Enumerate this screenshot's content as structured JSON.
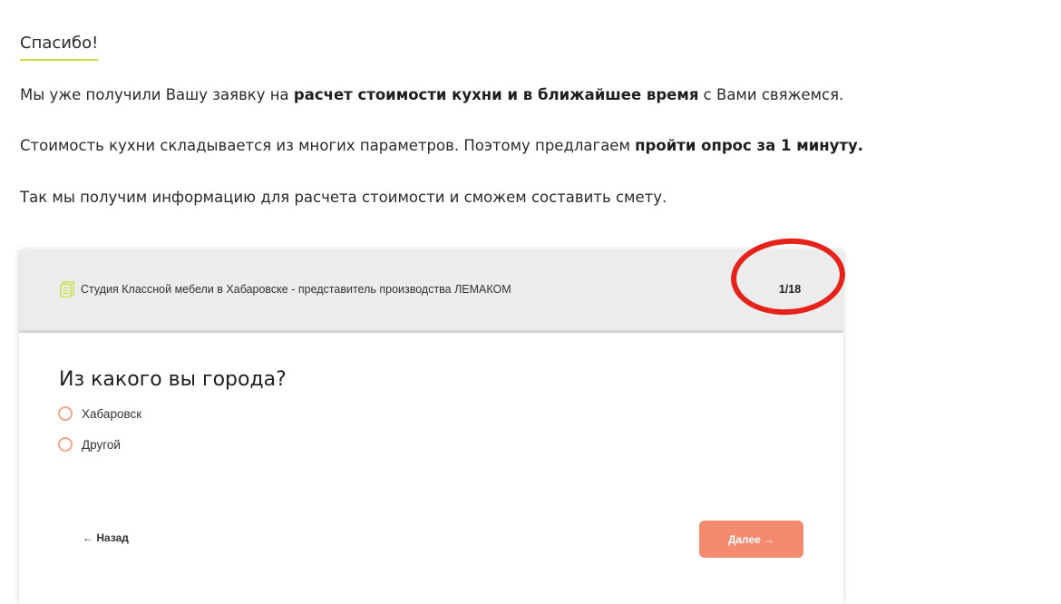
{
  "thanks": {
    "title": "Спасибо!"
  },
  "paragraphs": {
    "p1": {
      "before": "Мы уже получили Вашу заявку на ",
      "bold": "расчет стоимости кухни и в ближайшее время",
      "after": " с Вами свяжемся."
    },
    "p2": {
      "before": "Стоимость кухни складывается из многих параметров. Поэтому предлагаем ",
      "bold": "пройти опрос за 1 минуту."
    },
    "p3": {
      "text": "Так мы получим информацию для расчета стоимости и сможем составить смету."
    }
  },
  "quiz": {
    "studio_name": "Студия Классной мебели в Хабаровске - представитель производства ЛЕМАКОМ",
    "counter": "1/18",
    "question": "Из какого вы города?",
    "options": [
      {
        "label": "Хабаровск",
        "selected": false
      },
      {
        "label": "Другой",
        "selected": false
      }
    ],
    "back_label": "← Назад",
    "next_label": "Далее →"
  },
  "icons": {
    "header_icon": "document-icon",
    "highlight": "red-circle-annotation"
  },
  "colors": {
    "accent_underline": "#c7de3b",
    "next_button": "#f48b6f",
    "radio_border": "#f4a58b",
    "highlight_ring": "#e5231b",
    "header_bg": "#ececec",
    "doc_icon": "#c7de3b"
  }
}
